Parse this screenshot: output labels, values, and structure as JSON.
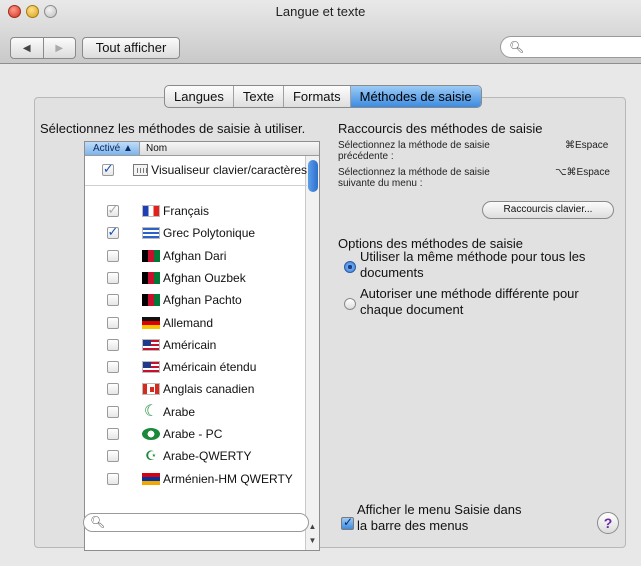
{
  "window": {
    "title": "Langue et texte"
  },
  "toolbar": {
    "back": "◀",
    "forward": "▶",
    "show_all": "Tout afficher",
    "search_placeholder": ""
  },
  "tabs": [
    {
      "label": "Langues",
      "active": false
    },
    {
      "label": "Texte",
      "active": false
    },
    {
      "label": "Formats",
      "active": false
    },
    {
      "label": "Méthodes de saisie",
      "active": true
    }
  ],
  "left": {
    "heading": "Sélectionnez les méthodes de saisie à utiliser.",
    "columns": {
      "active": "Activé",
      "sort_indicator": "▲",
      "name": "Nom"
    },
    "top_item": {
      "checked": true,
      "icon": "keyboard-icon",
      "name": "Visualiseur clavier/caractères"
    },
    "items": [
      {
        "checked": true,
        "dim": true,
        "flag": "fr",
        "name": "Français"
      },
      {
        "checked": true,
        "dim": false,
        "flag": "gr",
        "name": "Grec Polytonique"
      },
      {
        "checked": false,
        "dim": false,
        "flag": "af",
        "name": "Afghan Dari"
      },
      {
        "checked": false,
        "dim": false,
        "flag": "af",
        "name": "Afghan Ouzbek"
      },
      {
        "checked": false,
        "dim": false,
        "flag": "af",
        "name": "Afghan Pachto"
      },
      {
        "checked": false,
        "dim": false,
        "flag": "de",
        "name": "Allemand"
      },
      {
        "checked": false,
        "dim": false,
        "flag": "us",
        "name": "Américain"
      },
      {
        "checked": false,
        "dim": false,
        "flag": "us",
        "name": "Américain étendu"
      },
      {
        "checked": false,
        "dim": false,
        "flag": "ca",
        "name": "Anglais canadien"
      },
      {
        "checked": false,
        "dim": false,
        "flag": "ar",
        "name": "Arabe"
      },
      {
        "checked": false,
        "dim": false,
        "flag": "ar2",
        "name": "Arabe - PC"
      },
      {
        "checked": false,
        "dim": false,
        "flag": "ar3",
        "name": "Arabe-QWERTY"
      },
      {
        "checked": false,
        "dim": false,
        "flag": "am",
        "name": "Arménien-HM QWERTY"
      }
    ],
    "search_placeholder": ""
  },
  "right": {
    "shortcuts_title": "Raccourcis des méthodes de saisie",
    "prev_label_1": "Sélectionnez la méthode de saisie",
    "prev_label_2": "précédente :",
    "prev_key": "⌘Espace",
    "next_label_1": "Sélectionnez la méthode de saisie",
    "next_label_2": "suivante du menu :",
    "next_key": "⌥⌘Espace",
    "shortcuts_button": "Raccourcis clavier...",
    "options_title": "Options des méthodes de saisie",
    "option_same_1": "Utiliser la même méthode pour tous les",
    "option_same_2": "documents",
    "option_diff_1": "Autoriser une méthode différente pour",
    "option_diff_2": "chaque document",
    "selected_option": "same",
    "menu_checkbox_1": "Afficher le menu Saisie dans",
    "menu_checkbox_2": "la barre des menus",
    "menu_checked": true,
    "help": "?"
  }
}
